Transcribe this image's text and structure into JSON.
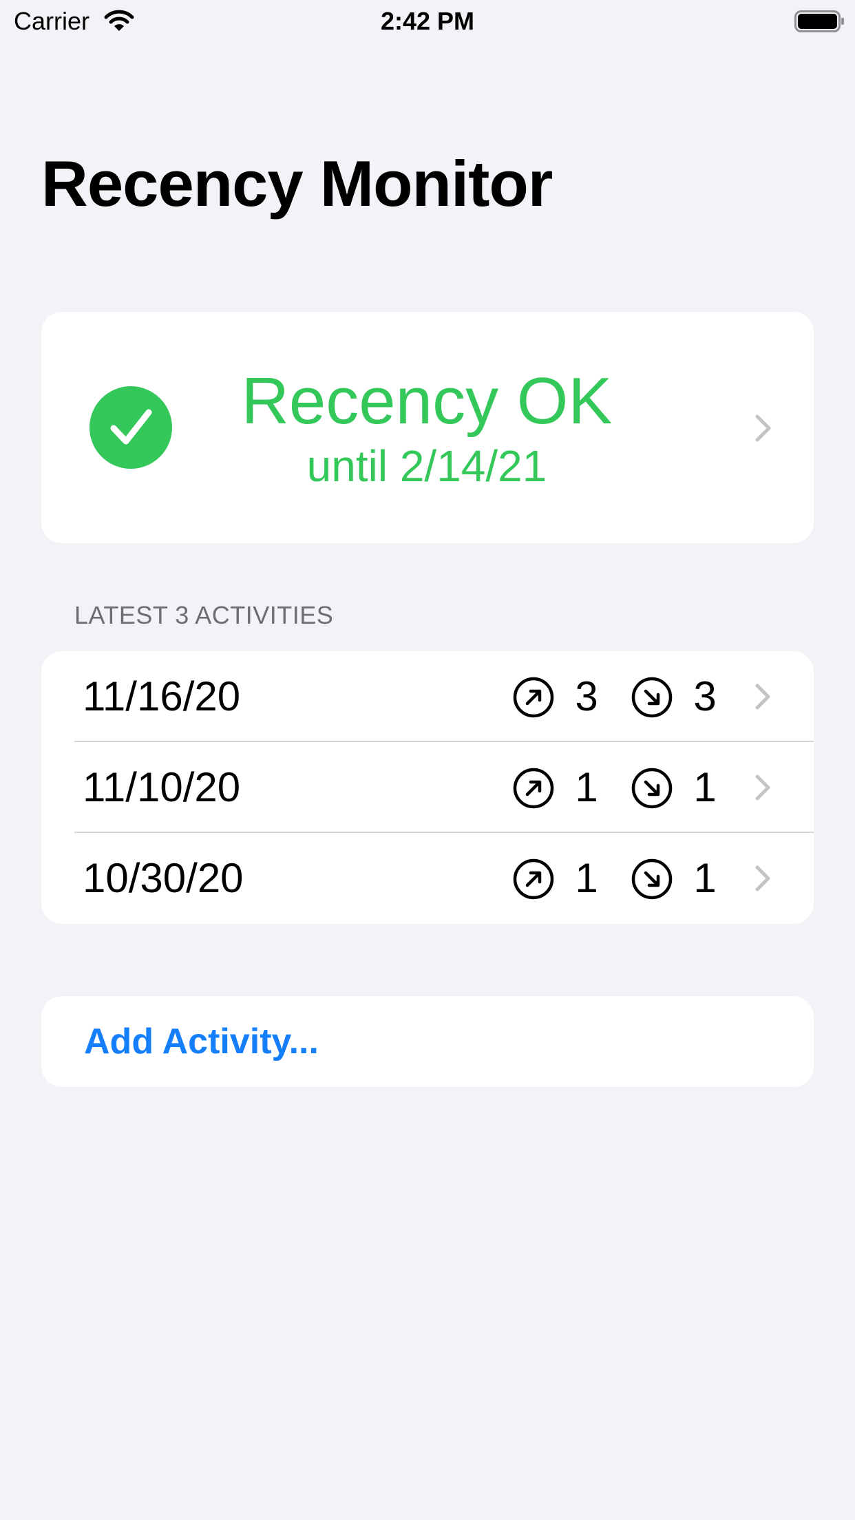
{
  "status_bar": {
    "carrier": "Carrier",
    "time": "2:42 PM"
  },
  "title": "Recency Monitor",
  "recency": {
    "status": "Recency OK",
    "until": "until 2/14/21",
    "color": "#34c759"
  },
  "activities": {
    "header": "LATEST 3 ACTIVITIES",
    "rows": [
      {
        "date": "11/16/20",
        "up": "3",
        "down": "3"
      },
      {
        "date": "11/10/20",
        "up": "1",
        "down": "1"
      },
      {
        "date": "10/30/20",
        "up": "1",
        "down": "1"
      }
    ]
  },
  "add_activity": {
    "label": "Add Activity...",
    "color": "#147efb"
  },
  "icons": {
    "status": "checkmark-circle-icon",
    "takeoff": "arrow-up-right-circle-icon",
    "landing": "arrow-down-right-circle-icon",
    "disclosure": "chevron-right-icon"
  }
}
